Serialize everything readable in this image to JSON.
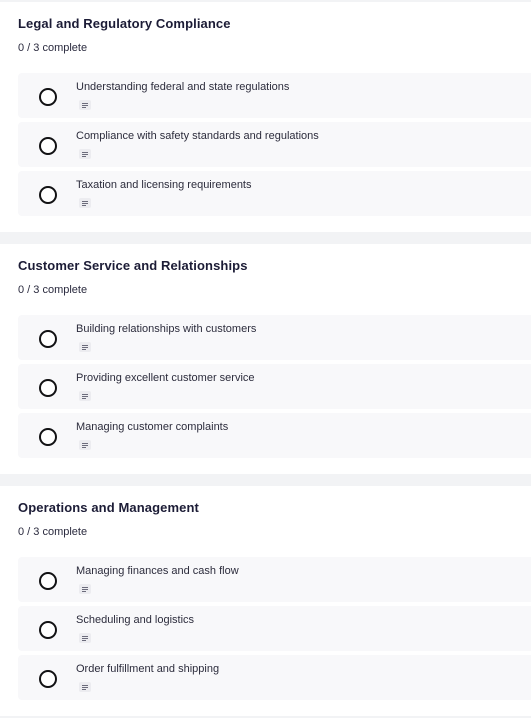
{
  "sections": [
    {
      "title": "Legal and Regulatory Compliance",
      "progress": "0 / 3 complete",
      "items": [
        {
          "label": "Understanding federal and state regulations",
          "checked": false
        },
        {
          "label": "Compliance with safety standards and regulations",
          "checked": false
        },
        {
          "label": "Taxation and licensing requirements",
          "checked": false
        }
      ]
    },
    {
      "title": "Customer Service and Relationships",
      "progress": "0 / 3 complete",
      "items": [
        {
          "label": "Building relationships with customers",
          "checked": false
        },
        {
          "label": "Providing excellent customer service",
          "checked": false
        },
        {
          "label": "Managing customer complaints",
          "checked": false
        }
      ]
    },
    {
      "title": "Operations and Management",
      "progress": "0 / 3 complete",
      "items": [
        {
          "label": "Managing finances and cash flow",
          "checked": false
        },
        {
          "label": "Scheduling and logistics",
          "checked": false
        },
        {
          "label": "Order fulfillment and shipping",
          "checked": false
        }
      ]
    }
  ],
  "colors": {
    "page_background": "#f2f3f5",
    "card_background": "#ffffff",
    "item_background": "#f8f8fa",
    "title_text": "#1c1c36",
    "checkbox_border": "#121214"
  },
  "icons": {
    "checkbox": "circle-outline-icon",
    "notes": "notes-icon"
  }
}
